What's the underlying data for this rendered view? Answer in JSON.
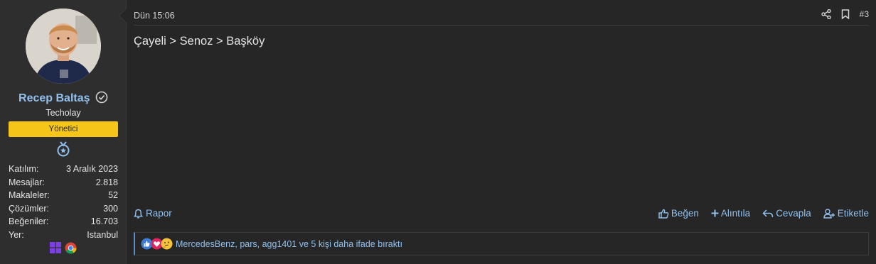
{
  "user": {
    "name": "Recep Baltaş",
    "title": "Techolay",
    "banner": "Yönetici",
    "stats": [
      {
        "label": "Katılım:",
        "value": "3 Aralık 2023"
      },
      {
        "label": "Mesajlar:",
        "value": "2.818"
      },
      {
        "label": "Makaleler:",
        "value": "52"
      },
      {
        "label": "Çözümler:",
        "value": "300"
      },
      {
        "label": "Beğeniler:",
        "value": "16.703"
      },
      {
        "label": "Yer:",
        "value": "Istanbul"
      }
    ]
  },
  "post": {
    "date": "Dün 15:06",
    "number": "#3",
    "body": "Çayeli > Senoz > Başköy"
  },
  "footer": {
    "report": "Rapor",
    "like": "Beğen",
    "quote": "Alıntıla",
    "reply": "Cevapla",
    "tag": "Etiketle"
  },
  "reactions": {
    "text": "MercedesBenz, pars, agg1401 ve 5 kişi daha ifade bıraktı"
  },
  "colors": {
    "link": "#8fc0ee",
    "banner": "#f5c518",
    "background": "#262626",
    "sidebar": "#2e2e2e"
  }
}
